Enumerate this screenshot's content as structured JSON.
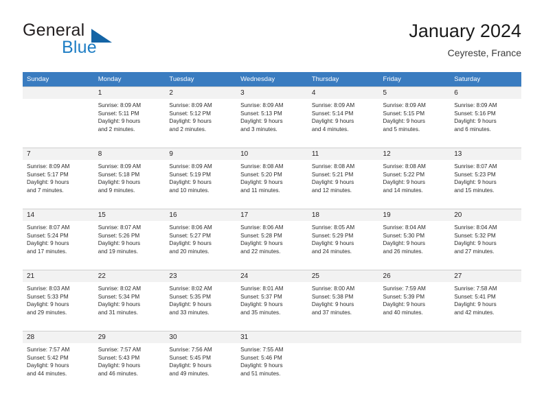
{
  "brand": {
    "name_part1": "General",
    "name_part2": "Blue",
    "triangle_color": "#1464a5",
    "blue_color": "#1d7dc4"
  },
  "header": {
    "title": "January 2024",
    "subtitle": "Ceyreste, France"
  },
  "theme": {
    "header_row_bg": "#3a7cc0",
    "daynum_band_bg": "#f2f2f2",
    "grid_line": "#cfcfcf"
  },
  "weekday_headers": [
    "Sunday",
    "Monday",
    "Tuesday",
    "Wednesday",
    "Thursday",
    "Friday",
    "Saturday"
  ],
  "weeks": [
    [
      {
        "day": "",
        "blank": true,
        "sunrise": "",
        "sunset": "",
        "daylight_line1": "",
        "daylight_line2": ""
      },
      {
        "day": "1",
        "sunrise": "Sunrise: 8:09 AM",
        "sunset": "Sunset: 5:11 PM",
        "daylight_line1": "Daylight: 9 hours",
        "daylight_line2": "and 2 minutes."
      },
      {
        "day": "2",
        "sunrise": "Sunrise: 8:09 AM",
        "sunset": "Sunset: 5:12 PM",
        "daylight_line1": "Daylight: 9 hours",
        "daylight_line2": "and 2 minutes."
      },
      {
        "day": "3",
        "sunrise": "Sunrise: 8:09 AM",
        "sunset": "Sunset: 5:13 PM",
        "daylight_line1": "Daylight: 9 hours",
        "daylight_line2": "and 3 minutes."
      },
      {
        "day": "4",
        "sunrise": "Sunrise: 8:09 AM",
        "sunset": "Sunset: 5:14 PM",
        "daylight_line1": "Daylight: 9 hours",
        "daylight_line2": "and 4 minutes."
      },
      {
        "day": "5",
        "sunrise": "Sunrise: 8:09 AM",
        "sunset": "Sunset: 5:15 PM",
        "daylight_line1": "Daylight: 9 hours",
        "daylight_line2": "and 5 minutes."
      },
      {
        "day": "6",
        "sunrise": "Sunrise: 8:09 AM",
        "sunset": "Sunset: 5:16 PM",
        "daylight_line1": "Daylight: 9 hours",
        "daylight_line2": "and 6 minutes."
      }
    ],
    [
      {
        "day": "7",
        "sunrise": "Sunrise: 8:09 AM",
        "sunset": "Sunset: 5:17 PM",
        "daylight_line1": "Daylight: 9 hours",
        "daylight_line2": "and 7 minutes."
      },
      {
        "day": "8",
        "sunrise": "Sunrise: 8:09 AM",
        "sunset": "Sunset: 5:18 PM",
        "daylight_line1": "Daylight: 9 hours",
        "daylight_line2": "and 9 minutes."
      },
      {
        "day": "9",
        "sunrise": "Sunrise: 8:09 AM",
        "sunset": "Sunset: 5:19 PM",
        "daylight_line1": "Daylight: 9 hours",
        "daylight_line2": "and 10 minutes."
      },
      {
        "day": "10",
        "sunrise": "Sunrise: 8:08 AM",
        "sunset": "Sunset: 5:20 PM",
        "daylight_line1": "Daylight: 9 hours",
        "daylight_line2": "and 11 minutes."
      },
      {
        "day": "11",
        "sunrise": "Sunrise: 8:08 AM",
        "sunset": "Sunset: 5:21 PM",
        "daylight_line1": "Daylight: 9 hours",
        "daylight_line2": "and 12 minutes."
      },
      {
        "day": "12",
        "sunrise": "Sunrise: 8:08 AM",
        "sunset": "Sunset: 5:22 PM",
        "daylight_line1": "Daylight: 9 hours",
        "daylight_line2": "and 14 minutes."
      },
      {
        "day": "13",
        "sunrise": "Sunrise: 8:07 AM",
        "sunset": "Sunset: 5:23 PM",
        "daylight_line1": "Daylight: 9 hours",
        "daylight_line2": "and 15 minutes."
      }
    ],
    [
      {
        "day": "14",
        "sunrise": "Sunrise: 8:07 AM",
        "sunset": "Sunset: 5:24 PM",
        "daylight_line1": "Daylight: 9 hours",
        "daylight_line2": "and 17 minutes."
      },
      {
        "day": "15",
        "sunrise": "Sunrise: 8:07 AM",
        "sunset": "Sunset: 5:26 PM",
        "daylight_line1": "Daylight: 9 hours",
        "daylight_line2": "and 19 minutes."
      },
      {
        "day": "16",
        "sunrise": "Sunrise: 8:06 AM",
        "sunset": "Sunset: 5:27 PM",
        "daylight_line1": "Daylight: 9 hours",
        "daylight_line2": "and 20 minutes."
      },
      {
        "day": "17",
        "sunrise": "Sunrise: 8:06 AM",
        "sunset": "Sunset: 5:28 PM",
        "daylight_line1": "Daylight: 9 hours",
        "daylight_line2": "and 22 minutes."
      },
      {
        "day": "18",
        "sunrise": "Sunrise: 8:05 AM",
        "sunset": "Sunset: 5:29 PM",
        "daylight_line1": "Daylight: 9 hours",
        "daylight_line2": "and 24 minutes."
      },
      {
        "day": "19",
        "sunrise": "Sunrise: 8:04 AM",
        "sunset": "Sunset: 5:30 PM",
        "daylight_line1": "Daylight: 9 hours",
        "daylight_line2": "and 26 minutes."
      },
      {
        "day": "20",
        "sunrise": "Sunrise: 8:04 AM",
        "sunset": "Sunset: 5:32 PM",
        "daylight_line1": "Daylight: 9 hours",
        "daylight_line2": "and 27 minutes."
      }
    ],
    [
      {
        "day": "21",
        "sunrise": "Sunrise: 8:03 AM",
        "sunset": "Sunset: 5:33 PM",
        "daylight_line1": "Daylight: 9 hours",
        "daylight_line2": "and 29 minutes."
      },
      {
        "day": "22",
        "sunrise": "Sunrise: 8:02 AM",
        "sunset": "Sunset: 5:34 PM",
        "daylight_line1": "Daylight: 9 hours",
        "daylight_line2": "and 31 minutes."
      },
      {
        "day": "23",
        "sunrise": "Sunrise: 8:02 AM",
        "sunset": "Sunset: 5:35 PM",
        "daylight_line1": "Daylight: 9 hours",
        "daylight_line2": "and 33 minutes."
      },
      {
        "day": "24",
        "sunrise": "Sunrise: 8:01 AM",
        "sunset": "Sunset: 5:37 PM",
        "daylight_line1": "Daylight: 9 hours",
        "daylight_line2": "and 35 minutes."
      },
      {
        "day": "25",
        "sunrise": "Sunrise: 8:00 AM",
        "sunset": "Sunset: 5:38 PM",
        "daylight_line1": "Daylight: 9 hours",
        "daylight_line2": "and 37 minutes."
      },
      {
        "day": "26",
        "sunrise": "Sunrise: 7:59 AM",
        "sunset": "Sunset: 5:39 PM",
        "daylight_line1": "Daylight: 9 hours",
        "daylight_line2": "and 40 minutes."
      },
      {
        "day": "27",
        "sunrise": "Sunrise: 7:58 AM",
        "sunset": "Sunset: 5:41 PM",
        "daylight_line1": "Daylight: 9 hours",
        "daylight_line2": "and 42 minutes."
      }
    ],
    [
      {
        "day": "28",
        "sunrise": "Sunrise: 7:57 AM",
        "sunset": "Sunset: 5:42 PM",
        "daylight_line1": "Daylight: 9 hours",
        "daylight_line2": "and 44 minutes."
      },
      {
        "day": "29",
        "sunrise": "Sunrise: 7:57 AM",
        "sunset": "Sunset: 5:43 PM",
        "daylight_line1": "Daylight: 9 hours",
        "daylight_line2": "and 46 minutes."
      },
      {
        "day": "30",
        "sunrise": "Sunrise: 7:56 AM",
        "sunset": "Sunset: 5:45 PM",
        "daylight_line1": "Daylight: 9 hours",
        "daylight_line2": "and 49 minutes."
      },
      {
        "day": "31",
        "sunrise": "Sunrise: 7:55 AM",
        "sunset": "Sunset: 5:46 PM",
        "daylight_line1": "Daylight: 9 hours",
        "daylight_line2": "and 51 minutes."
      },
      {
        "day": "",
        "blank": true,
        "sunrise": "",
        "sunset": "",
        "daylight_line1": "",
        "daylight_line2": ""
      },
      {
        "day": "",
        "blank": true,
        "sunrise": "",
        "sunset": "",
        "daylight_line1": "",
        "daylight_line2": ""
      },
      {
        "day": "",
        "blank": true,
        "sunrise": "",
        "sunset": "",
        "daylight_line1": "",
        "daylight_line2": ""
      }
    ]
  ]
}
